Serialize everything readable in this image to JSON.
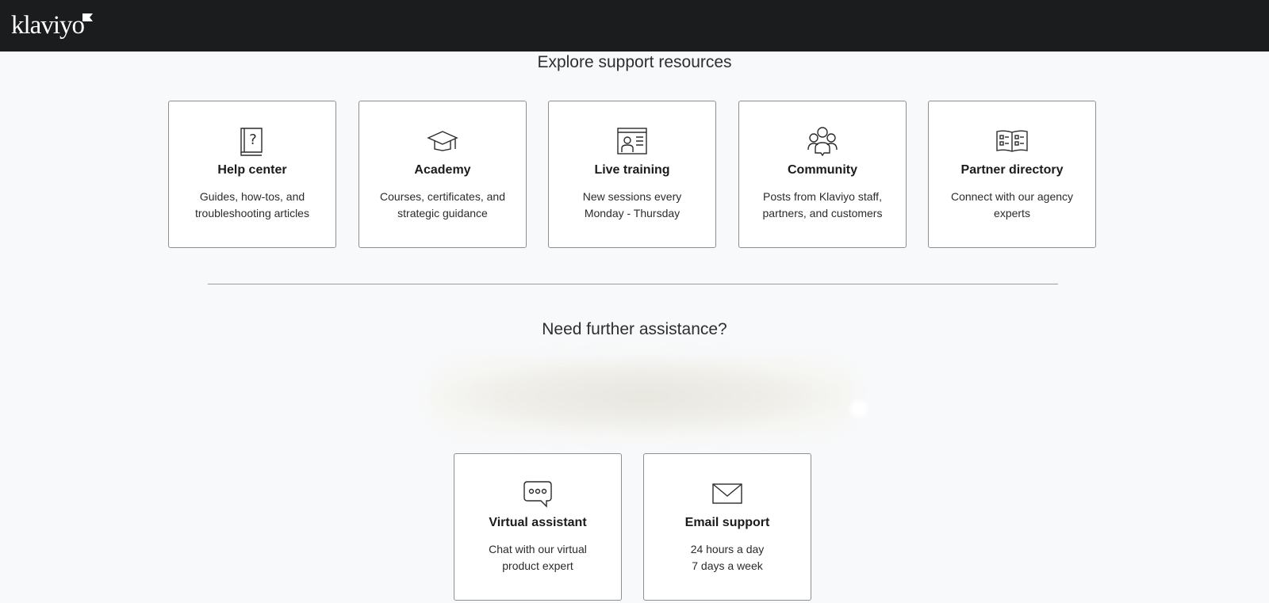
{
  "brand": {
    "logo_text": "klaviyo"
  },
  "explore": {
    "title": "Explore support resources",
    "cards": [
      {
        "title": "Help center",
        "desc_line1": "Guides, how-tos, and",
        "desc_line2": "troubleshooting articles",
        "icon": "help-book-icon"
      },
      {
        "title": "Academy",
        "desc_line1": "Courses, certificates, and",
        "desc_line2": "strategic guidance",
        "icon": "graduation-cap-icon"
      },
      {
        "title": "Live training",
        "desc_line1": "New sessions every",
        "desc_line2": "Monday - Thursday",
        "icon": "video-presenter-icon"
      },
      {
        "title": "Community",
        "desc_line1": "Posts from Klaviyo staff,",
        "desc_line2": "partners, and customers",
        "icon": "people-group-icon"
      },
      {
        "title": "Partner directory",
        "desc_line1": "Connect with our agency",
        "desc_line2": "experts",
        "icon": "directory-book-icon"
      }
    ]
  },
  "assistance": {
    "title": "Need further assistance?",
    "cards": [
      {
        "title": "Virtual assistant",
        "desc_line1": "Chat with our virtual",
        "desc_line2": "product expert",
        "icon": "chat-bubble-icon"
      },
      {
        "title": "Email support",
        "desc_line1": "24 hours a day",
        "desc_line2": "7 days a week",
        "icon": "envelope-icon"
      }
    ]
  },
  "colors": {
    "topbar": "#1b1c1e",
    "page_background": "#f8f9fa",
    "card_border": "#8e8f91"
  }
}
